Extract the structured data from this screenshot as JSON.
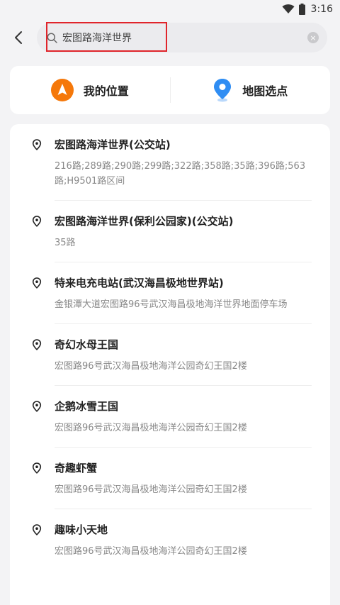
{
  "status_bar": {
    "time": "3:16"
  },
  "search": {
    "value": "宏图路海洋世界",
    "placeholder": ""
  },
  "quick_actions": [
    {
      "label": "我的位置",
      "icon": "navigation-arrow-icon",
      "color": "#f5780a"
    },
    {
      "label": "地图选点",
      "icon": "map-pin-icon",
      "color": "#2f8df3"
    }
  ],
  "results": [
    {
      "title": "宏图路海洋世界(公交站)",
      "subtitle": "216路;289路;290路;299路;322路;358路;35路;396路;563路;H9501路区间"
    },
    {
      "title": "宏图路海洋世界(保利公园家)(公交站)",
      "subtitle": "35路"
    },
    {
      "title": "特来电充电站(武汉海昌极地世界站)",
      "subtitle": "金银潭大道宏图路96号武汉海昌极地海洋世界地面停车场"
    },
    {
      "title": "奇幻水母王国",
      "subtitle": "宏图路96号武汉海昌极地海洋公园奇幻王国2楼"
    },
    {
      "title": "企鹅冰雪王国",
      "subtitle": "宏图路96号武汉海昌极地海洋公园奇幻王国2楼"
    },
    {
      "title": "奇趣虾蟹",
      "subtitle": "宏图路96号武汉海昌极地海洋公园奇幻王国2楼"
    },
    {
      "title": "趣味小天地",
      "subtitle": "宏图路96号武汉海昌极地海洋公园奇幻王国2楼"
    }
  ]
}
